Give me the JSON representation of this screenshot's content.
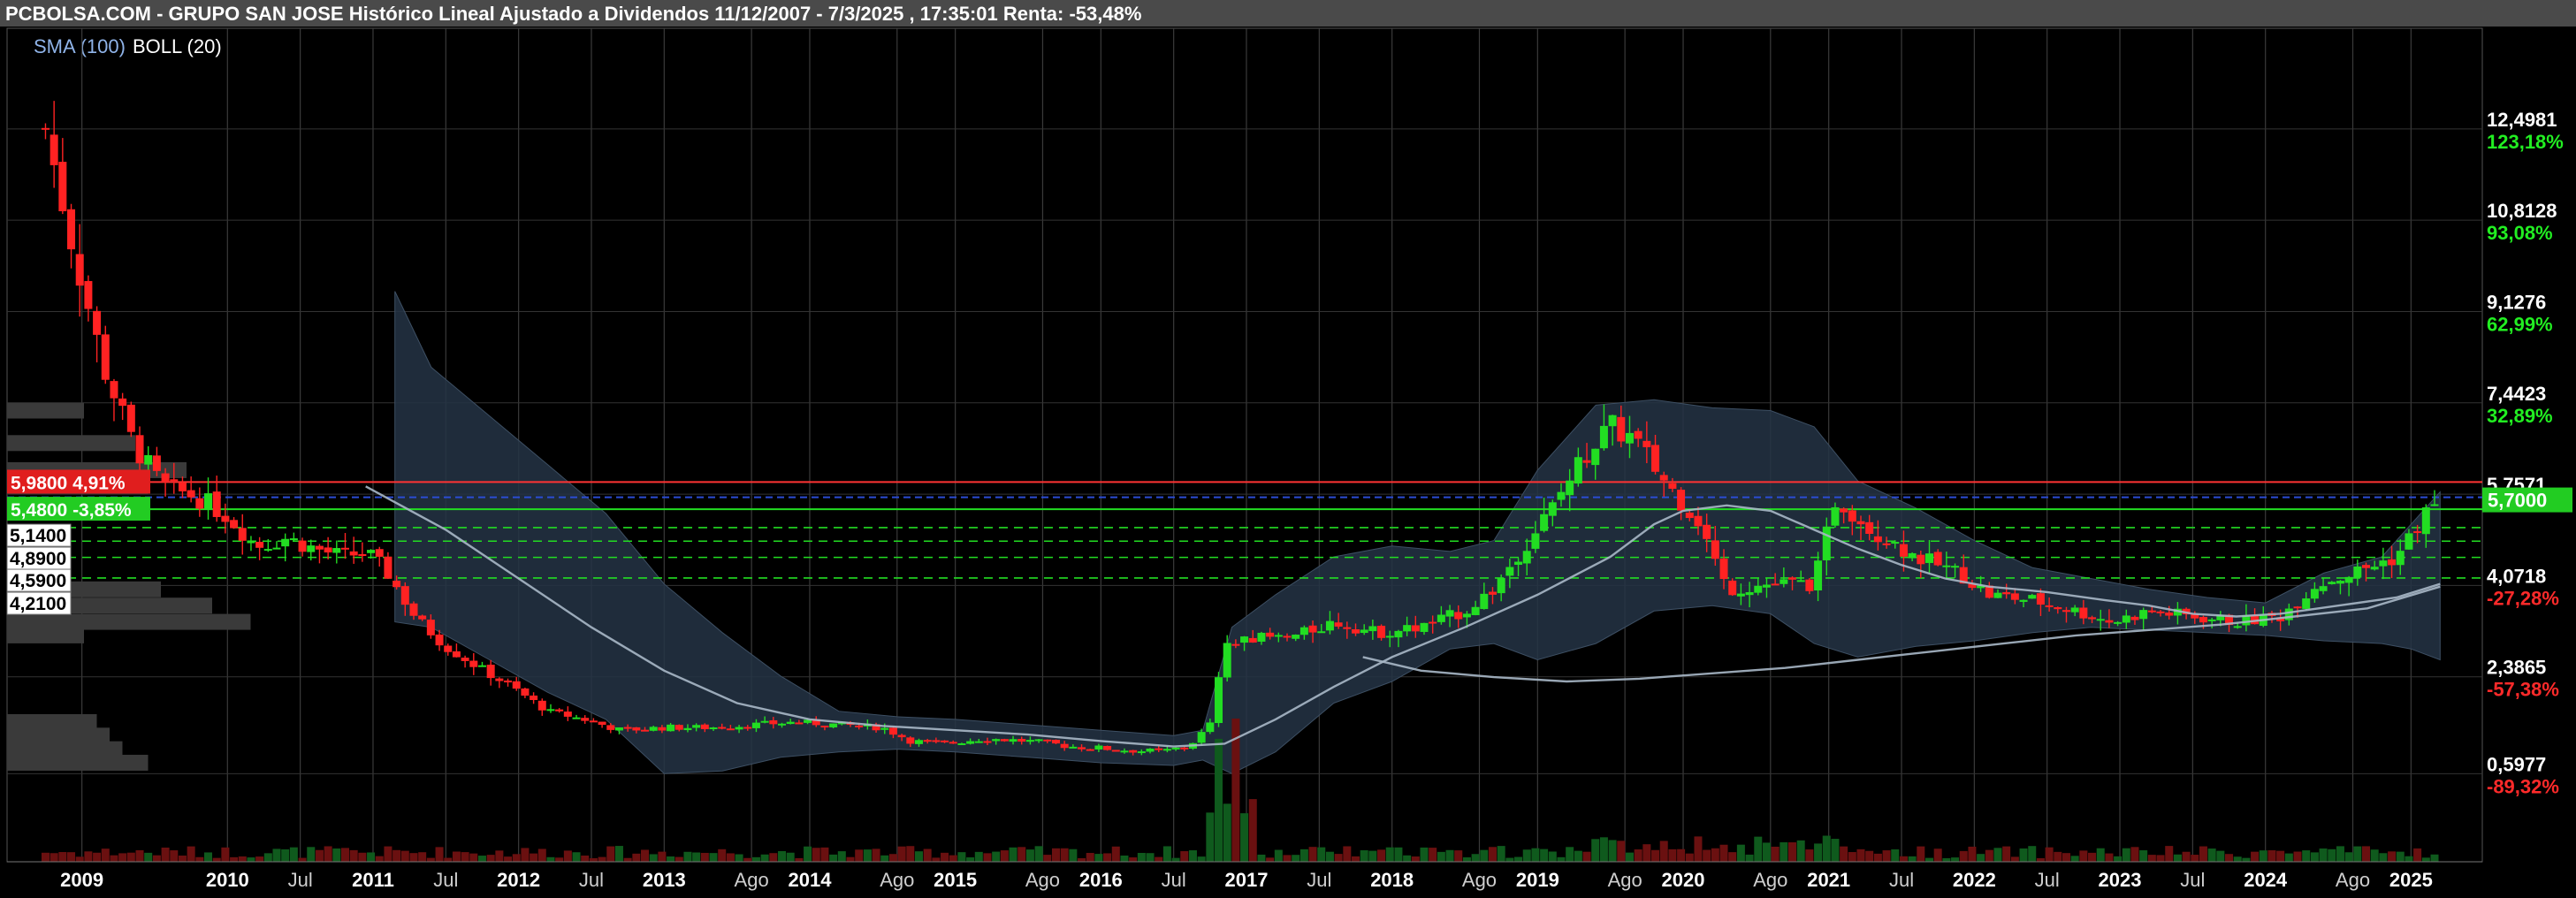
{
  "header": {
    "title": "PCBOLSA.COM - GRUPO SAN JOSE Histórico Lineal Ajustado a Dividendos 11/12/2007 - 7/3/2025 , 17:35:01 Renta: -53,48%"
  },
  "legend": {
    "sma_label": "SMA (100)",
    "boll_label": "BOLL (20)"
  },
  "colors": {
    "up": "#22dd22",
    "down": "#ff2222",
    "sma": "#a9b8c8",
    "band_fill": "#253445",
    "axis_price": "#ffffff",
    "axis_pct_up": "#22ee22",
    "axis_pct_down": "#ff2a2a",
    "resistance": "#ff3333",
    "support": "#22dd22",
    "current": "#2b4cd4",
    "volume_up": "#0f5a1d",
    "volume_down": "#6a1010",
    "volume_profile": "#3a3a3a"
  },
  "right_axis": [
    {
      "price": "12,4981",
      "pct": "123,18%",
      "value": 12.4981,
      "pct_dir": "up"
    },
    {
      "price": "10,8128",
      "pct": "93,08%",
      "value": 10.8128,
      "pct_dir": "up"
    },
    {
      "price": "9,1276",
      "pct": "62,99%",
      "value": 9.1276,
      "pct_dir": "up"
    },
    {
      "price": "7,4423",
      "pct": "32,89%",
      "value": 7.4423,
      "pct_dir": "up"
    },
    {
      "price": "5,7571",
      "pct": "",
      "value": 5.7571,
      "pct_dir": "up"
    },
    {
      "price": "4,0718",
      "pct": "-27,28%",
      "value": 4.0718,
      "pct_dir": "down"
    },
    {
      "price": "2,3865",
      "pct": "-57,38%",
      "value": 2.3865,
      "pct_dir": "down"
    },
    {
      "price": "0,5977",
      "pct": "-89,32%",
      "value": 0.5977,
      "pct_dir": "down"
    }
  ],
  "current_price_tag": "5,7000",
  "left_tags": {
    "resistance": {
      "price": "5,9800",
      "pct": "4,91%"
    },
    "support": {
      "price": "5,4800",
      "pct": "-3,85%"
    },
    "levels": [
      "5,1400",
      "4,8900",
      "4,5900",
      "4,2100"
    ]
  },
  "x_axis_labels": [
    {
      "label": "2009",
      "t": 2009.0,
      "year": true
    },
    {
      "label": "2010",
      "t": 2010.0,
      "year": true
    },
    {
      "label": "Jul",
      "t": 2010.5,
      "year": false
    },
    {
      "label": "2011",
      "t": 2011.0,
      "year": true
    },
    {
      "label": "Jul",
      "t": 2011.5,
      "year": false
    },
    {
      "label": "2012",
      "t": 2012.0,
      "year": true
    },
    {
      "label": "Jul",
      "t": 2012.5,
      "year": false
    },
    {
      "label": "2013",
      "t": 2013.0,
      "year": true
    },
    {
      "label": "Ago",
      "t": 2013.6,
      "year": false
    },
    {
      "label": "2014",
      "t": 2014.0,
      "year": true
    },
    {
      "label": "Ago",
      "t": 2014.6,
      "year": false
    },
    {
      "label": "2015",
      "t": 2015.0,
      "year": true
    },
    {
      "label": "Ago",
      "t": 2015.6,
      "year": false
    },
    {
      "label": "2016",
      "t": 2016.0,
      "year": true
    },
    {
      "label": "Jul",
      "t": 2016.5,
      "year": false
    },
    {
      "label": "2017",
      "t": 2017.0,
      "year": true
    },
    {
      "label": "Jul",
      "t": 2017.5,
      "year": false
    },
    {
      "label": "2018",
      "t": 2018.0,
      "year": true
    },
    {
      "label": "Ago",
      "t": 2018.6,
      "year": false
    },
    {
      "label": "2019",
      "t": 2019.0,
      "year": true
    },
    {
      "label": "Ago",
      "t": 2019.6,
      "year": false
    },
    {
      "label": "2020",
      "t": 2020.0,
      "year": true
    },
    {
      "label": "Ago",
      "t": 2020.6,
      "year": false
    },
    {
      "label": "2021",
      "t": 2021.0,
      "year": true
    },
    {
      "label": "Jul",
      "t": 2021.5,
      "year": false
    },
    {
      "label": "2022",
      "t": 2022.0,
      "year": true
    },
    {
      "label": "Jul",
      "t": 2022.5,
      "year": false
    },
    {
      "label": "2023",
      "t": 2023.0,
      "year": true
    },
    {
      "label": "Jul",
      "t": 2023.5,
      "year": false
    },
    {
      "label": "2024",
      "t": 2024.0,
      "year": true
    },
    {
      "label": "Ago",
      "t": 2024.6,
      "year": false
    },
    {
      "label": "2025",
      "t": 2025.0,
      "year": true
    }
  ],
  "chart_data": {
    "type": "candlestick",
    "title": "PCBOLSA.COM - GRUPO SAN JOSE Histórico Lineal Ajustado a Dividendos 11/12/2007 - 7/3/2025 , 17:35:01 Renta: -53,48%",
    "x_start": 2008.65,
    "x_end": 2025.35,
    "ylim": [
      0.0,
      13.3
    ],
    "grid": true,
    "legend": "top-left",
    "indicators": [
      "SMA (100)",
      "BOLL (20)"
    ],
    "horizontal_levels": {
      "resistance": 5.98,
      "support": 5.48,
      "current": 5.7,
      "dashed": [
        5.14,
        4.89,
        4.59,
        4.21
      ]
    },
    "anchors": [
      [
        2008.75,
        12.5
      ],
      [
        2008.95,
        10.2
      ],
      [
        2009.15,
        8.1
      ],
      [
        2009.35,
        6.7
      ],
      [
        2009.55,
        5.9
      ],
      [
        2009.8,
        5.7
      ],
      [
        2010.0,
        5.35
      ],
      [
        2010.2,
        4.8
      ],
      [
        2010.4,
        4.95
      ],
      [
        2010.6,
        4.75
      ],
      [
        2010.8,
        4.6
      ],
      [
        2010.95,
        4.7
      ],
      [
        2011.1,
        4.3
      ],
      [
        2011.3,
        3.45
      ],
      [
        2011.5,
        2.95
      ],
      [
        2011.7,
        2.6
      ],
      [
        2011.95,
        2.2
      ],
      [
        2012.2,
        1.75
      ],
      [
        2012.45,
        1.6
      ],
      [
        2012.7,
        1.4
      ],
      [
        2013.0,
        1.45
      ],
      [
        2013.3,
        1.45
      ],
      [
        2013.6,
        1.5
      ],
      [
        2013.9,
        1.55
      ],
      [
        2014.2,
        1.5
      ],
      [
        2014.5,
        1.45
      ],
      [
        2014.7,
        1.2
      ],
      [
        2014.9,
        1.15
      ],
      [
        2015.2,
        1.25
      ],
      [
        2015.5,
        1.2
      ],
      [
        2015.8,
        1.1
      ],
      [
        2016.1,
        1.05
      ],
      [
        2016.4,
        1.0
      ],
      [
        2016.6,
        1.1
      ],
      [
        2016.75,
        1.5
      ],
      [
        2016.85,
        2.9
      ],
      [
        2017.0,
        3.1
      ],
      [
        2017.3,
        3.1
      ],
      [
        2017.6,
        3.4
      ],
      [
        2017.9,
        3.2
      ],
      [
        2018.2,
        3.3
      ],
      [
        2018.5,
        3.6
      ],
      [
        2018.7,
        4.0
      ],
      [
        2018.85,
        4.6
      ],
      [
        2019.1,
        5.5
      ],
      [
        2019.3,
        6.4
      ],
      [
        2019.5,
        7.0
      ],
      [
        2019.65,
        6.8
      ],
      [
        2019.9,
        5.9
      ],
      [
        2020.1,
        5.3
      ],
      [
        2020.3,
        4.0
      ],
      [
        2020.6,
        4.1
      ],
      [
        2020.9,
        4.1
      ],
      [
        2021.05,
        5.7
      ],
      [
        2021.3,
        5.1
      ],
      [
        2021.6,
        4.6
      ],
      [
        2021.9,
        4.3
      ],
      [
        2022.1,
        3.9
      ],
      [
        2022.4,
        3.8
      ],
      [
        2022.7,
        3.6
      ],
      [
        2022.95,
        3.4
      ],
      [
        2023.2,
        3.6
      ],
      [
        2023.5,
        3.5
      ],
      [
        2023.8,
        3.4
      ],
      [
        2024.1,
        3.5
      ],
      [
        2024.35,
        4.1
      ],
      [
        2024.6,
        4.3
      ],
      [
        2024.9,
        4.6
      ],
      [
        2025.1,
        5.4
      ],
      [
        2025.2,
        5.7
      ]
    ],
    "sma": [
      [
        2010.95,
        5.9
      ],
      [
        2011.5,
        5.1
      ],
      [
        2012.0,
        4.2
      ],
      [
        2012.5,
        3.3
      ],
      [
        2013.0,
        2.5
      ],
      [
        2013.5,
        1.9
      ],
      [
        2014.0,
        1.6
      ],
      [
        2014.5,
        1.48
      ],
      [
        2015.0,
        1.4
      ],
      [
        2015.5,
        1.32
      ],
      [
        2016.0,
        1.2
      ],
      [
        2016.5,
        1.1
      ],
      [
        2016.85,
        1.15
      ],
      [
        2017.2,
        1.6
      ],
      [
        2017.6,
        2.2
      ],
      [
        2018.0,
        2.75
      ],
      [
        2018.5,
        3.3
      ],
      [
        2019.0,
        3.9
      ],
      [
        2019.5,
        4.6
      ],
      [
        2019.8,
        5.2
      ],
      [
        2020.0,
        5.45
      ],
      [
        2020.3,
        5.55
      ],
      [
        2020.6,
        5.45
      ],
      [
        2020.9,
        5.1
      ],
      [
        2021.2,
        4.75
      ],
      [
        2021.5,
        4.45
      ],
      [
        2021.8,
        4.2
      ],
      [
        2022.1,
        4.05
      ],
      [
        2022.5,
        3.95
      ],
      [
        2022.9,
        3.8
      ],
      [
        2023.2,
        3.7
      ],
      [
        2023.5,
        3.55
      ],
      [
        2023.8,
        3.5
      ],
      [
        2024.1,
        3.55
      ],
      [
        2024.5,
        3.7
      ],
      [
        2024.9,
        3.85
      ],
      [
        2025.2,
        4.1
      ]
    ],
    "sma_long": [
      [
        2017.8,
        2.75
      ],
      [
        2018.2,
        2.5
      ],
      [
        2018.7,
        2.38
      ],
      [
        2019.2,
        2.3
      ],
      [
        2019.7,
        2.35
      ],
      [
        2020.2,
        2.45
      ],
      [
        2020.7,
        2.55
      ],
      [
        2021.2,
        2.7
      ],
      [
        2021.7,
        2.85
      ],
      [
        2022.2,
        3.0
      ],
      [
        2022.7,
        3.15
      ],
      [
        2023.2,
        3.25
      ],
      [
        2023.7,
        3.35
      ],
      [
        2024.2,
        3.5
      ],
      [
        2024.7,
        3.65
      ],
      [
        2025.2,
        4.05
      ]
    ],
    "boll_upper": [
      [
        2011.15,
        9.5
      ],
      [
        2011.4,
        8.1
      ],
      [
        2011.8,
        7.2
      ],
      [
        2012.2,
        6.3
      ],
      [
        2012.6,
        5.4
      ],
      [
        2013.0,
        4.1
      ],
      [
        2013.4,
        3.2
      ],
      [
        2013.8,
        2.4
      ],
      [
        2014.2,
        1.75
      ],
      [
        2014.6,
        1.65
      ],
      [
        2015.0,
        1.6
      ],
      [
        2015.5,
        1.5
      ],
      [
        2016.0,
        1.4
      ],
      [
        2016.5,
        1.3
      ],
      [
        2016.7,
        1.4
      ],
      [
        2016.9,
        3.3
      ],
      [
        2017.2,
        3.9
      ],
      [
        2017.6,
        4.6
      ],
      [
        2018.0,
        4.8
      ],
      [
        2018.4,
        4.7
      ],
      [
        2018.7,
        4.9
      ],
      [
        2019.0,
        6.2
      ],
      [
        2019.4,
        7.4
      ],
      [
        2019.8,
        7.5
      ],
      [
        2020.2,
        7.35
      ],
      [
        2020.6,
        7.3
      ],
      [
        2020.9,
        7.0
      ],
      [
        2021.2,
        6.0
      ],
      [
        2021.6,
        5.5
      ],
      [
        2022.0,
        4.9
      ],
      [
        2022.4,
        4.4
      ],
      [
        2022.8,
        4.2
      ],
      [
        2023.2,
        4.0
      ],
      [
        2023.6,
        3.85
      ],
      [
        2024.0,
        3.75
      ],
      [
        2024.4,
        4.3
      ],
      [
        2024.8,
        4.6
      ],
      [
        2025.0,
        5.2
      ],
      [
        2025.2,
        5.8
      ]
    ],
    "boll_lower": [
      [
        2011.15,
        3.4
      ],
      [
        2011.4,
        3.3
      ],
      [
        2011.8,
        2.7
      ],
      [
        2012.2,
        2.1
      ],
      [
        2012.6,
        1.6
      ],
      [
        2013.0,
        0.6
      ],
      [
        2013.4,
        0.65
      ],
      [
        2013.8,
        0.9
      ],
      [
        2014.2,
        1.0
      ],
      [
        2014.6,
        1.05
      ],
      [
        2015.0,
        1.0
      ],
      [
        2015.5,
        0.9
      ],
      [
        2016.0,
        0.8
      ],
      [
        2016.5,
        0.75
      ],
      [
        2016.7,
        0.85
      ],
      [
        2016.9,
        0.6
      ],
      [
        2017.2,
        1.0
      ],
      [
        2017.6,
        1.9
      ],
      [
        2018.0,
        2.3
      ],
      [
        2018.4,
        2.9
      ],
      [
        2018.7,
        3.0
      ],
      [
        2019.0,
        2.7
      ],
      [
        2019.4,
        3.0
      ],
      [
        2019.8,
        3.6
      ],
      [
        2020.2,
        3.7
      ],
      [
        2020.6,
        3.55
      ],
      [
        2020.9,
        3.0
      ],
      [
        2021.2,
        2.75
      ],
      [
        2021.6,
        2.95
      ],
      [
        2022.0,
        3.05
      ],
      [
        2022.4,
        3.2
      ],
      [
        2022.8,
        3.3
      ],
      [
        2023.2,
        3.25
      ],
      [
        2023.6,
        3.2
      ],
      [
        2024.0,
        3.15
      ],
      [
        2024.4,
        3.05
      ],
      [
        2024.8,
        3.0
      ],
      [
        2025.0,
        2.9
      ],
      [
        2025.2,
        2.7
      ]
    ],
    "volume_profile": [
      {
        "price": 7.3,
        "value": 0.3
      },
      {
        "price": 6.7,
        "value": 0.5
      },
      {
        "price": 6.2,
        "value": 0.7
      },
      {
        "price": 5.9,
        "value": 0.55
      },
      {
        "price": 4.0,
        "value": 0.6
      },
      {
        "price": 3.7,
        "value": 0.8
      },
      {
        "price": 3.4,
        "value": 0.95
      },
      {
        "price": 3.15,
        "value": 0.3
      },
      {
        "price": 1.55,
        "value": 0.35
      },
      {
        "price": 1.3,
        "value": 0.4
      },
      {
        "price": 1.05,
        "value": 0.45
      },
      {
        "price": 0.8,
        "value": 0.55
      }
    ]
  }
}
